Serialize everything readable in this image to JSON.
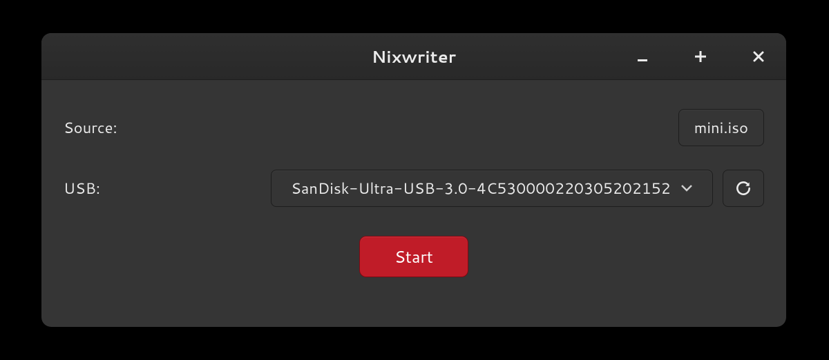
{
  "window": {
    "title": "Nixwriter"
  },
  "source": {
    "label": "Source:",
    "file_button": "mini.iso"
  },
  "usb": {
    "label": "USB:",
    "selected": "SanDisk-Ultra-USB-3.0-4C530000220305202152"
  },
  "actions": {
    "start": "Start"
  }
}
